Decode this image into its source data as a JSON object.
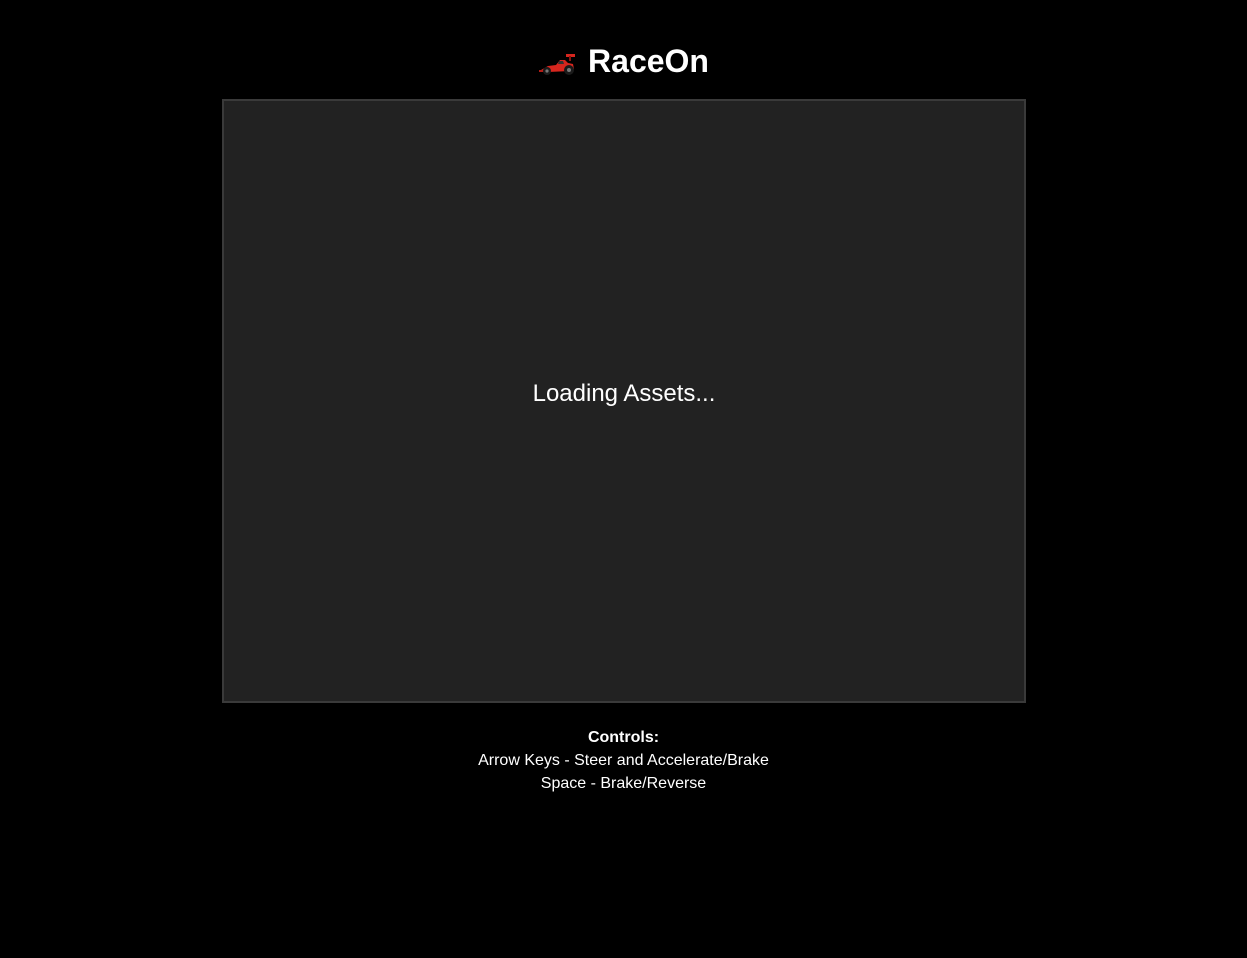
{
  "header": {
    "icon": "race-car-icon",
    "title": "RaceOn"
  },
  "game": {
    "status_text": "Loading Assets..."
  },
  "controls": {
    "heading": "Controls:",
    "lines": [
      "Arrow Keys - Steer and Accelerate/Brake",
      "Space - Brake/Reverse"
    ]
  },
  "colors": {
    "background": "#000000",
    "canvas": "#222222",
    "canvas_border": "#3a3a3a",
    "text": "#ffffff",
    "car_red": "#d7261e"
  }
}
